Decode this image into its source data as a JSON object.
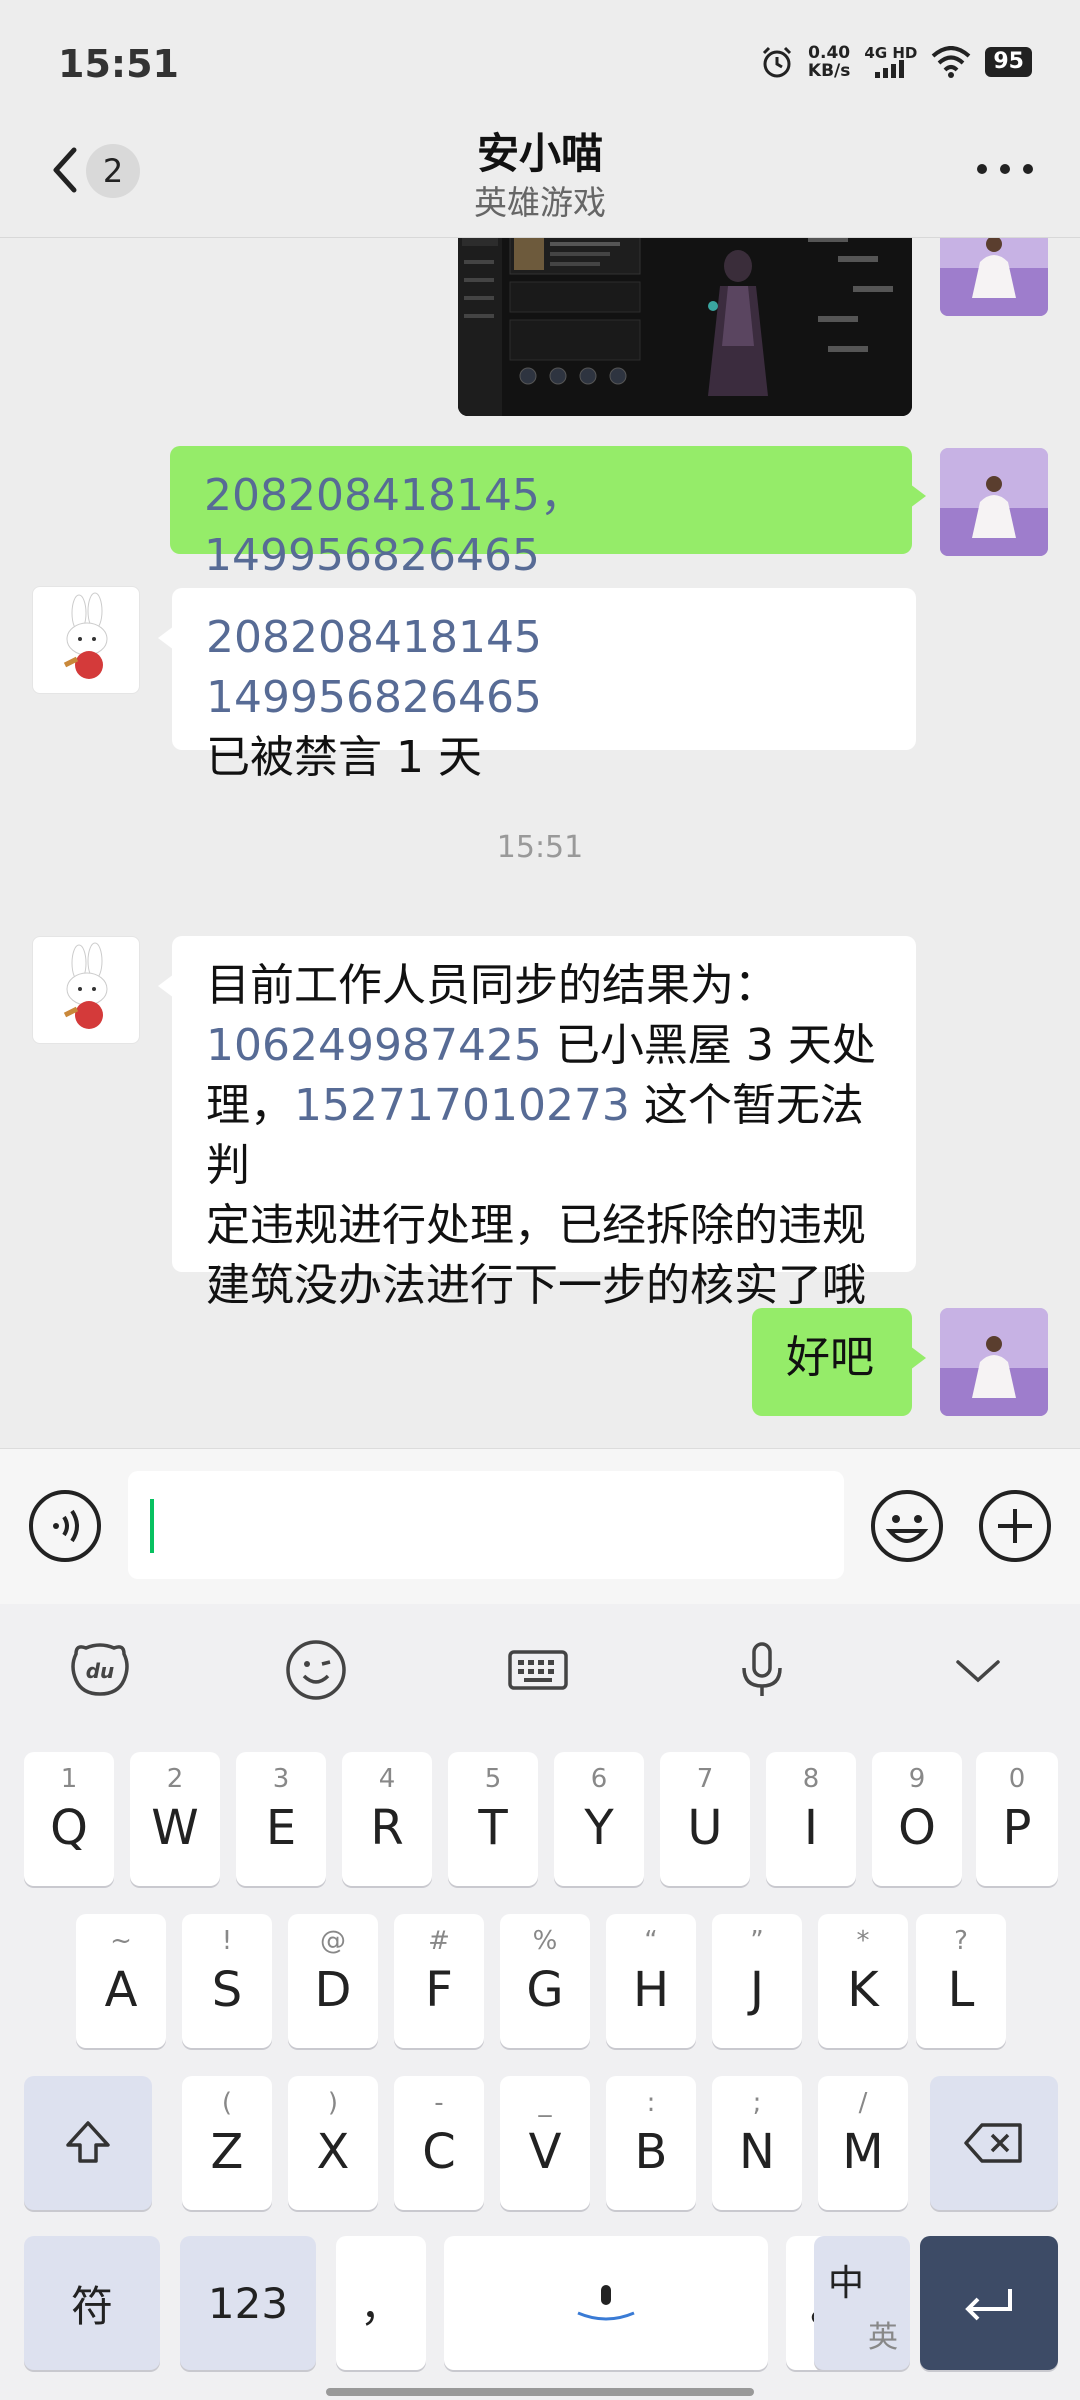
{
  "status_bar": {
    "time": "15:51",
    "speed_value": "0.40",
    "speed_unit": "KB/s",
    "network": "4G HD",
    "battery": "95"
  },
  "header": {
    "unread_count": "2",
    "title": "安小喵",
    "subtitle": "英雄游戏"
  },
  "messages": {
    "m1_text": "208208418145，149956826465",
    "m2_number": "208208418145 149956826465",
    "m2_text": "已被禁言 1 天",
    "timestamp": "15:51",
    "m3_line1": "目前工作人员同步的结果为：",
    "m3_num1": "106249987425",
    "m3_text1": " 已小黑屋 3 天处",
    "m3_text2": "理，",
    "m3_num2": "152717010273",
    "m3_text3": " 这个暂无法判",
    "m3_line4": "定违规进行处理，已经拆除的违规",
    "m3_line5": "建筑没办法进行下一步的核实了哦",
    "m4_text": "好吧"
  },
  "input": {
    "value": ""
  },
  "keyboard": {
    "row1": [
      {
        "hint": "1",
        "key": "Q"
      },
      {
        "hint": "2",
        "key": "W"
      },
      {
        "hint": "3",
        "key": "E"
      },
      {
        "hint": "4",
        "key": "R"
      },
      {
        "hint": "5",
        "key": "T"
      },
      {
        "hint": "6",
        "key": "Y"
      },
      {
        "hint": "7",
        "key": "U"
      },
      {
        "hint": "8",
        "key": "I"
      },
      {
        "hint": "9",
        "key": "O"
      },
      {
        "hint": "0",
        "key": "P"
      }
    ],
    "row2": [
      {
        "hint": "~",
        "key": "A"
      },
      {
        "hint": "!",
        "key": "S"
      },
      {
        "hint": "@",
        "key": "D"
      },
      {
        "hint": "#",
        "key": "F"
      },
      {
        "hint": "%",
        "key": "G"
      },
      {
        "hint": "“",
        "key": "H"
      },
      {
        "hint": "”",
        "key": "J"
      },
      {
        "hint": "*",
        "key": "K"
      },
      {
        "hint": "?",
        "key": "L"
      }
    ],
    "row3": [
      {
        "hint": "(",
        "key": "Z"
      },
      {
        "hint": ")",
        "key": "X"
      },
      {
        "hint": "-",
        "key": "C"
      },
      {
        "hint": "_",
        "key": "V"
      },
      {
        "hint": ":",
        "key": "B"
      },
      {
        "hint": ";",
        "key": "N"
      },
      {
        "hint": "/",
        "key": "M"
      }
    ],
    "symbols": "符",
    "numbers": "123",
    "comma": "，",
    "period": "。",
    "lang_main": "中",
    "lang_alt": "英"
  }
}
